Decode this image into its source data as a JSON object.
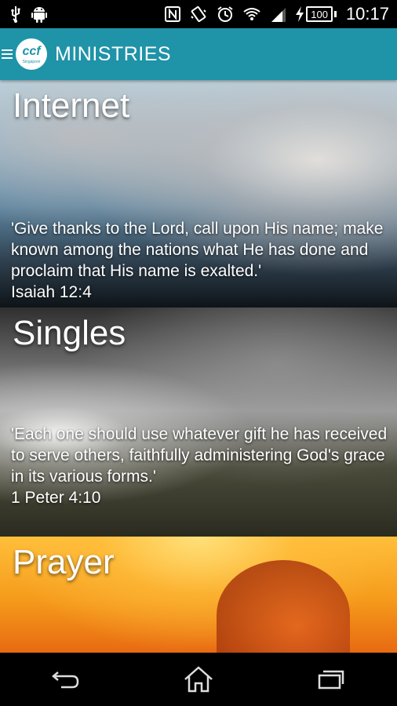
{
  "status_bar": {
    "time": "10:17",
    "battery": "100",
    "icons": [
      "usb-icon",
      "android-icon",
      "nfc-icon",
      "vibrate-icon",
      "alarm-icon",
      "wifi-icon",
      "signal-icon",
      "charging-icon"
    ]
  },
  "app_bar": {
    "logo_text": "ccf",
    "logo_subtext": "Singapore",
    "title": "MINISTRIES",
    "accent": "#1f93a8"
  },
  "ministries": [
    {
      "title": "Internet",
      "quote": "'Give thanks to the Lord, call upon His name; make known among the nations what He has done and proclaim that His name is exalted.'",
      "reference": "Isaiah 12:4"
    },
    {
      "title": "Singles",
      "quote": "'Each one should use whatever gift he has received to serve others, faithfully administering God's grace in its various forms.'",
      "reference": "1 Peter 4:10"
    },
    {
      "title": "Prayer",
      "quote": "",
      "reference": ""
    }
  ],
  "nav_bar": {
    "icons": [
      "back-icon",
      "home-icon",
      "recent-apps-icon"
    ]
  }
}
